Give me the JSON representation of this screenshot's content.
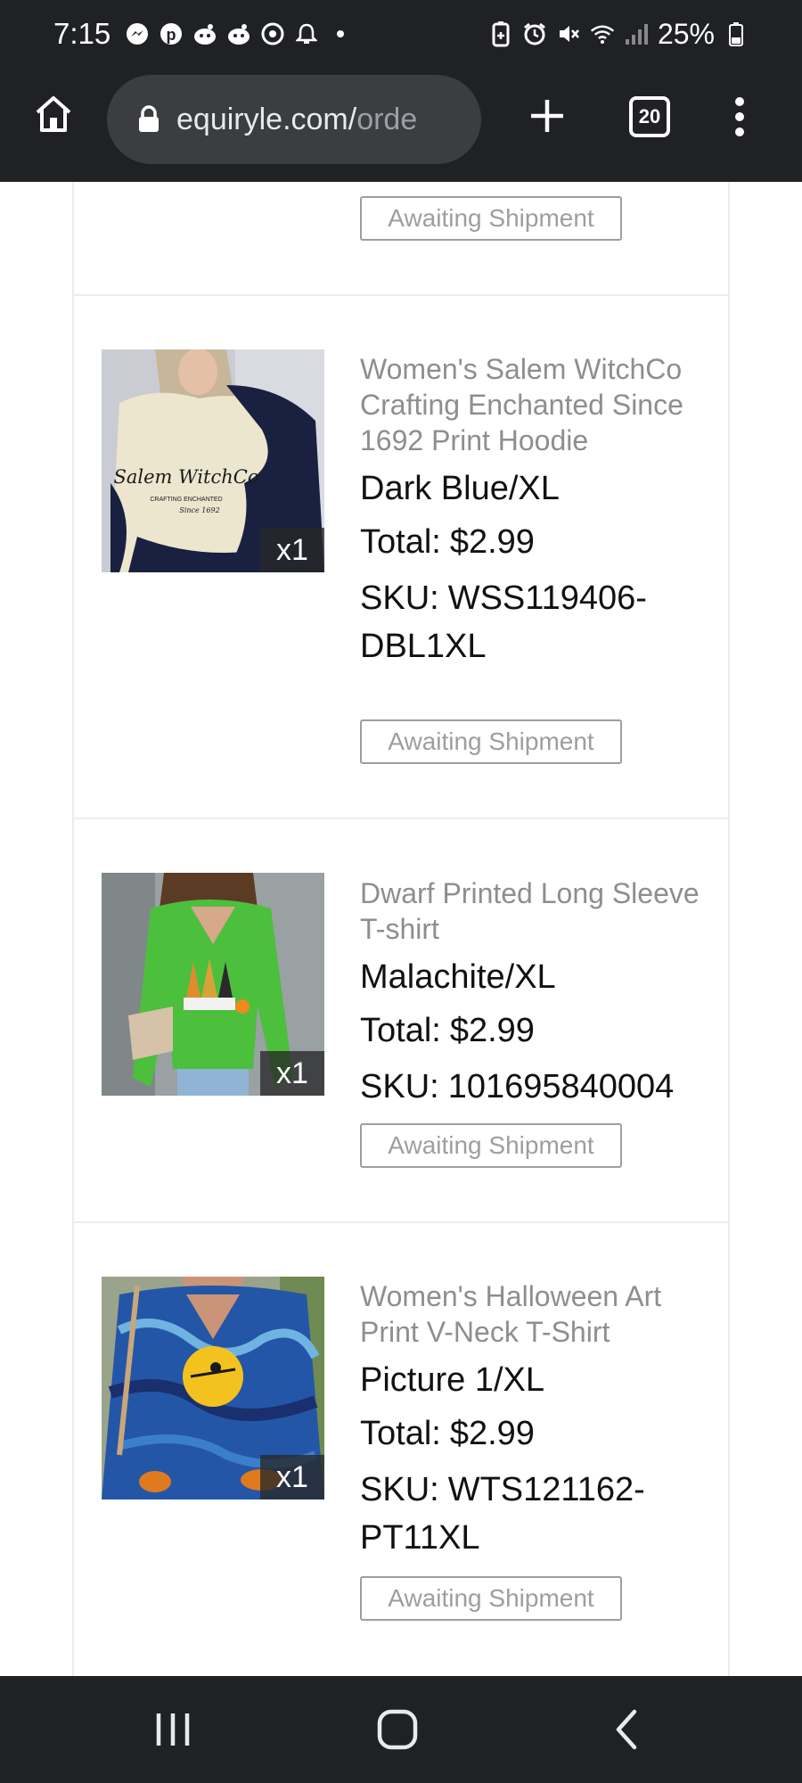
{
  "status_bar": {
    "time": "7:15",
    "notification_icons": [
      "messenger-icon",
      "pinterest-icon",
      "reddit-icon",
      "reddit-icon",
      "chrome-icon",
      "bell-icon",
      "dot-icon"
    ],
    "system_icons": [
      "battery-saver-icon",
      "alarm-icon",
      "mute-icon",
      "wifi-icon",
      "signal-icon",
      "battery-icon"
    ],
    "battery_percent": "25%"
  },
  "browser": {
    "url_host": "equiryle.com/",
    "url_path": "orde",
    "tab_count": "20"
  },
  "orders": {
    "prev_status": "Awaiting Shipment",
    "items": [
      {
        "name": "Women's Salem WitchCo Crafting Enchanted Since 1692 Print Hoodie",
        "variant": "Dark Blue/XL",
        "total_label": "Total:",
        "total": "$2.99",
        "sku_label": "SKU:",
        "sku": "WSS119406-DBL1XL",
        "quantity": "x1",
        "status": "Awaiting Shipment"
      },
      {
        "name": "Dwarf Printed Long Sleeve T-shirt",
        "variant": "Malachite/XL",
        "total_label": "Total:",
        "total": "$2.99",
        "sku_label": "SKU:",
        "sku": "101695840004",
        "quantity": "x1",
        "status": "Awaiting Shipment"
      },
      {
        "name": "Women's Halloween Art Print V-Neck T-Shirt",
        "variant": "Picture 1/XL",
        "total_label": "Total:",
        "total": "$2.99",
        "sku_label": "SKU:",
        "sku": "WTS121162-PT11XL",
        "quantity": "x1",
        "status": "Awaiting Shipment"
      }
    ],
    "hoodie_print_text": [
      "Salem WitchCo",
      "CRAFTING ENCHANTED",
      "Since 1692"
    ]
  },
  "nav_bar": {
    "buttons": [
      "recent-apps-icon",
      "home-icon",
      "back-icon"
    ]
  }
}
